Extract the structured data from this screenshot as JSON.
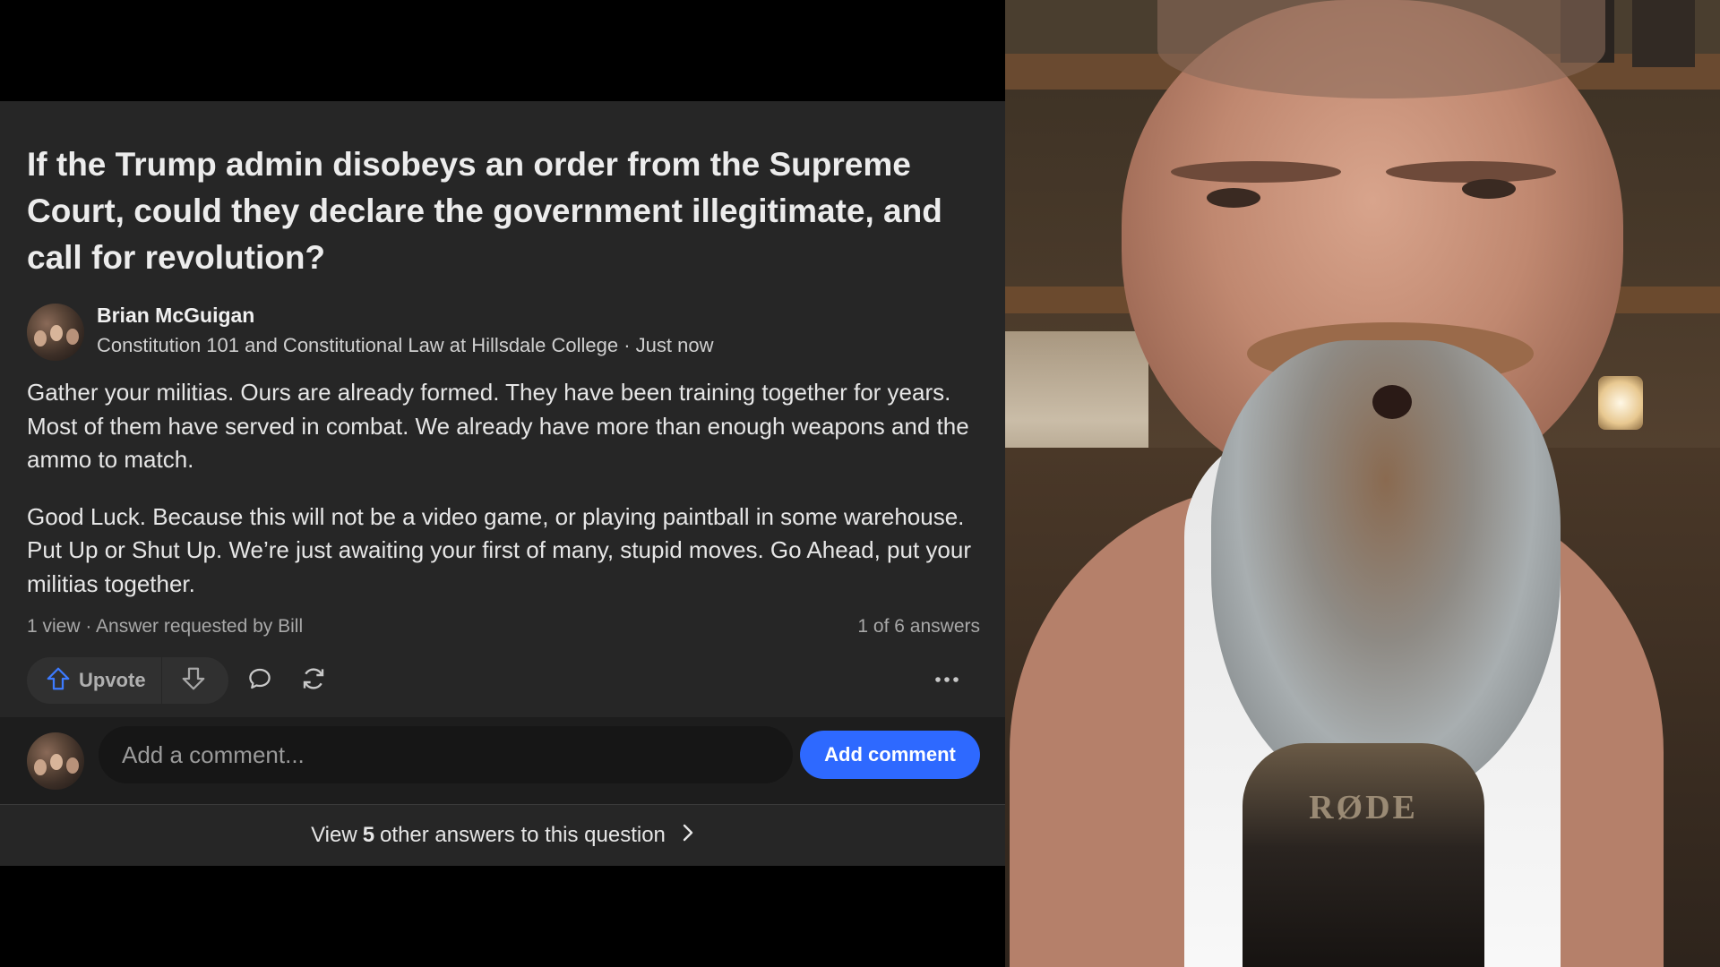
{
  "question": {
    "title": "If the Trump admin disobeys an order from the Supreme Court, could they declare the government illegitimate, and call for revolution?"
  },
  "author": {
    "name": "Brian McGuigan",
    "credential": "Constitution 101 and Constitutional Law at Hillsdale College · Just now"
  },
  "answer": {
    "paragraphs": [
      "Gather your militias. Ours are already formed. They have been training together for years. Most of them have served in combat. We already have more than enough weapons and the ammo to match.",
      "Good Luck. Because this will not be a video game, or playing paintball in some warehouse. Put Up or Shut Up. We’re just awaiting your first of many, stupid moves. Go Ahead, put your militias together."
    ]
  },
  "meta": {
    "views": "1 view · Answer requested by Bill",
    "position": "1 of 6 answers"
  },
  "actions": {
    "upvote_label": "Upvote",
    "icons": [
      "upvote-arrow-icon",
      "downvote-arrow-icon",
      "comment-bubble-icon",
      "share-refresh-icon",
      "more-dots-icon"
    ]
  },
  "comment": {
    "placeholder": "Add a comment...",
    "button_label": "Add comment"
  },
  "view_others": {
    "prefix": "View",
    "count": "5",
    "suffix": "other answers to this question"
  },
  "video": {
    "mic_brand": "RØDE"
  },
  "colors": {
    "card_bg": "#262626",
    "accent_blue": "#2e69ff",
    "page_bg": "#000000"
  }
}
